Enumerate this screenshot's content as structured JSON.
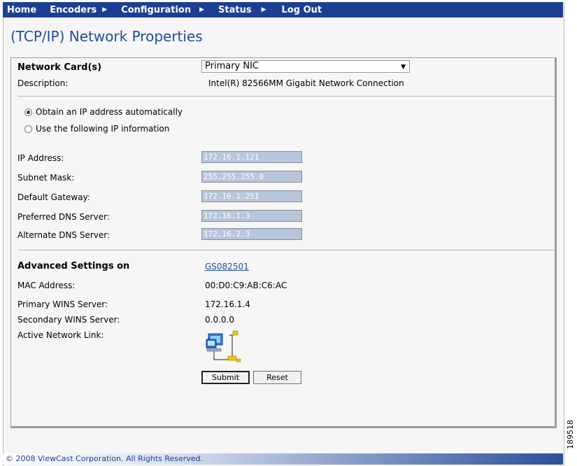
{
  "nav": {
    "items": [
      {
        "label": "Home",
        "arrow": false
      },
      {
        "label": "Encoders",
        "arrow": true
      },
      {
        "label": "Configuration",
        "arrow": true
      },
      {
        "label": "Status",
        "arrow": true
      },
      {
        "label": "Log Out",
        "arrow": false
      }
    ]
  },
  "page": {
    "title": "(TCP/IP) Network Properties"
  },
  "network_card": {
    "label": "Network Card(s)",
    "selected": "Primary NIC",
    "description_label": "Description:",
    "description_value": "Intel(R) 82566MM Gigabit Network Connection"
  },
  "ip_mode": {
    "auto_label": "Obtain an IP address automatically",
    "manual_label": "Use the following IP information",
    "selected": "auto"
  },
  "ip_fields": [
    {
      "label": "IP Address:",
      "value": "172.16.1.121"
    },
    {
      "label": "Subnet Mask:",
      "value": "255.255.255.0"
    },
    {
      "label": "Default Gateway:",
      "value": "172.16.1.251"
    },
    {
      "label": "Preferred DNS Server:",
      "value": "172.16.1.3"
    },
    {
      "label": "Alternate DNS Server:",
      "value": "172.16.2.3"
    }
  ],
  "advanced": {
    "label": "Advanced Settings on",
    "host_link": "GS082501",
    "mac_label": "MAC Address:",
    "mac_value": "00:D0:C9:AB:C6:AC",
    "wins1_label": "Primary WINS Server:",
    "wins1_value": "172.16.1.4",
    "wins2_label": "Secondary WINS Server:",
    "wins2_value": "0.0.0.0",
    "link_label": "Active Network Link:",
    "link_icon": "network-connection-icon"
  },
  "buttons": {
    "submit": "Submit",
    "reset": "Reset"
  },
  "footer": {
    "copyright": "© 2008 ViewCast Corporation. All Rights Reserved."
  },
  "figure_id": "189518",
  "colors": {
    "nav_bg": "#1c3f93",
    "title": "#1f4c9e",
    "field_bg": "#b6c6dc"
  }
}
